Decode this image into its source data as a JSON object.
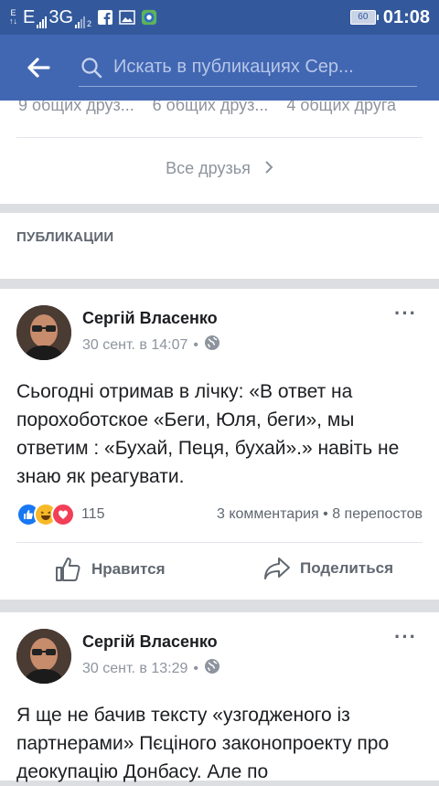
{
  "status_bar": {
    "net_small_top": "E",
    "net_small_bottom": "↑↓",
    "network_e": "E",
    "network_3g": "3G",
    "sim2": "2",
    "battery": "60",
    "time": "01:08"
  },
  "header": {
    "search_placeholder": "Искать в публикациях Сер..."
  },
  "friends": {
    "mutual": [
      "9 общих друз...",
      "6 общих друз...",
      "4 общих друга"
    ],
    "all_friends": "Все друзья"
  },
  "publications": {
    "title": "ПУБЛИКАЦИИ"
  },
  "posts": [
    {
      "author": "Сергій Власенко",
      "date": "30 сент. в 14:07",
      "more": "···",
      "text": "Сьогодні отримав в лічку: «В ответ на порохоботское «Беги, Юля, беги», мы ответим : «Бухай, Пеця, бухай».» навіть не знаю як реагувати.",
      "reactions_count": "115",
      "comments": "3 комментария",
      "shares": "8 перепостов",
      "like_label": "Нравится",
      "share_label": "Поделиться"
    },
    {
      "author": "Сергій Власенко",
      "date": "30 сент. в 13:29",
      "more": "···",
      "text": "Я ще не бачив тексту «узгодженого із партнерами» Пєціного законопроекту про деокупацію Донбасу. Але по"
    }
  ],
  "colors": {
    "status_bar": "#33599c",
    "app_bar": "#4267b2",
    "like_blue": "#1877f2",
    "haha_yellow": "#f7b928",
    "love_red": "#f33e58"
  }
}
